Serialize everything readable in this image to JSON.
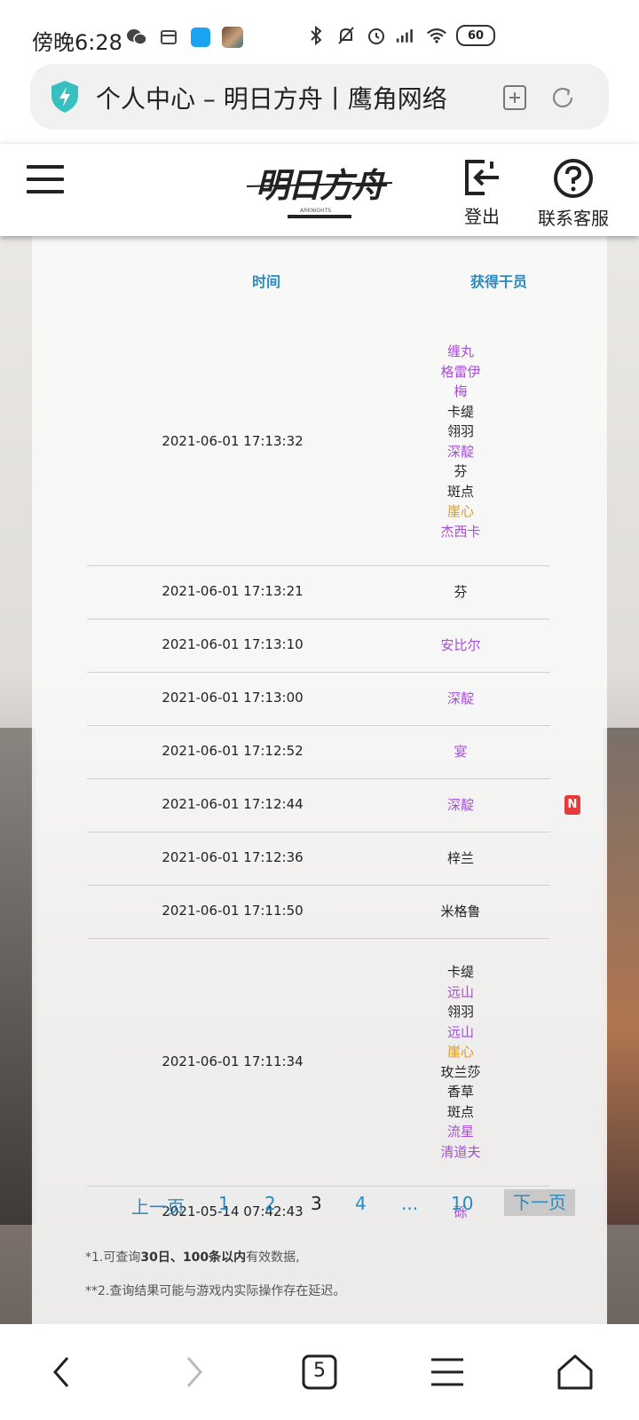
{
  "status_bar": {
    "time": "傍晚6:28",
    "battery": "60",
    "icons_left": [
      "wechat-icon",
      "message-icon",
      "app-blue-icon",
      "app-avatar-icon"
    ],
    "icons_right": [
      "bluetooth-icon",
      "mute-icon",
      "alarm-icon",
      "signal-icon",
      "wifi-icon",
      "battery-icon"
    ]
  },
  "browser": {
    "url_title": "个人中心 – 明日方舟丨鹰角网络",
    "shield_color": "#38c0c0"
  },
  "header": {
    "logout_label": "登出",
    "support_label": "联系客服",
    "logo_text": "明日方舟",
    "logo_subtext": "ARKNIGHTS"
  },
  "table": {
    "col_time": "时间",
    "col_operator": "获得干员",
    "rows": [
      {
        "time": "2021-06-01 17:13:32",
        "ops": [
          {
            "name": "缠丸",
            "rarity": "purple"
          },
          {
            "name": "格雷伊",
            "rarity": "purple"
          },
          {
            "name": "梅",
            "rarity": "purple"
          },
          {
            "name": "卡缇",
            "rarity": "black"
          },
          {
            "name": "翎羽",
            "rarity": "black"
          },
          {
            "name": "深靛",
            "rarity": "purple"
          },
          {
            "name": "芬",
            "rarity": "black"
          },
          {
            "name": "斑点",
            "rarity": "black"
          },
          {
            "name": "崖心",
            "rarity": "gold"
          },
          {
            "name": "杰西卡",
            "rarity": "purple"
          }
        ]
      },
      {
        "time": "2021-06-01 17:13:21",
        "ops": [
          {
            "name": "芬",
            "rarity": "black"
          }
        ]
      },
      {
        "time": "2021-06-01 17:13:10",
        "ops": [
          {
            "name": "安比尔",
            "rarity": "purple"
          }
        ]
      },
      {
        "time": "2021-06-01 17:13:00",
        "ops": [
          {
            "name": "深靛",
            "rarity": "purple"
          }
        ]
      },
      {
        "time": "2021-06-01 17:12:52",
        "ops": [
          {
            "name": "宴",
            "rarity": "purple"
          }
        ]
      },
      {
        "time": "2021-06-01 17:12:44",
        "ops": [
          {
            "name": "深靛",
            "rarity": "purple"
          }
        ],
        "badge": "N"
      },
      {
        "time": "2021-06-01 17:12:36",
        "ops": [
          {
            "name": "梓兰",
            "rarity": "black"
          }
        ]
      },
      {
        "time": "2021-06-01 17:11:50",
        "ops": [
          {
            "name": "米格鲁",
            "rarity": "black"
          }
        ]
      },
      {
        "time": "2021-06-01 17:11:34",
        "ops": [
          {
            "name": "卡缇",
            "rarity": "black"
          },
          {
            "name": "远山",
            "rarity": "purple"
          },
          {
            "name": "翎羽",
            "rarity": "black"
          },
          {
            "name": "远山",
            "rarity": "purple"
          },
          {
            "name": "崖心",
            "rarity": "gold"
          },
          {
            "name": "玫兰莎",
            "rarity": "black"
          },
          {
            "name": "香草",
            "rarity": "black"
          },
          {
            "name": "斑点",
            "rarity": "black"
          },
          {
            "name": "流星",
            "rarity": "purple"
          },
          {
            "name": "清道夫",
            "rarity": "purple"
          }
        ]
      },
      {
        "time": "2021-05-14 07:42:43",
        "ops": [
          {
            "name": "砾",
            "rarity": "purple"
          }
        ]
      }
    ]
  },
  "pagination": {
    "prev": "上一页",
    "pages": [
      "1",
      "2",
      "3",
      "4",
      "...",
      "10"
    ],
    "current": "3",
    "next": "下一页"
  },
  "notes": {
    "note1_prefix": "*1.可查询",
    "note1_bold": "30日、100条以内",
    "note1_suffix": "有效数据,",
    "note2": "**2.查询结果可能与游戏内实际操作存在延迟。"
  },
  "nav": {
    "tab_count": "5"
  },
  "colors": {
    "accent": "#2a8abf",
    "purple": "#a64fd6",
    "gold": "#d99b2b",
    "badge": "#e53b3b"
  }
}
